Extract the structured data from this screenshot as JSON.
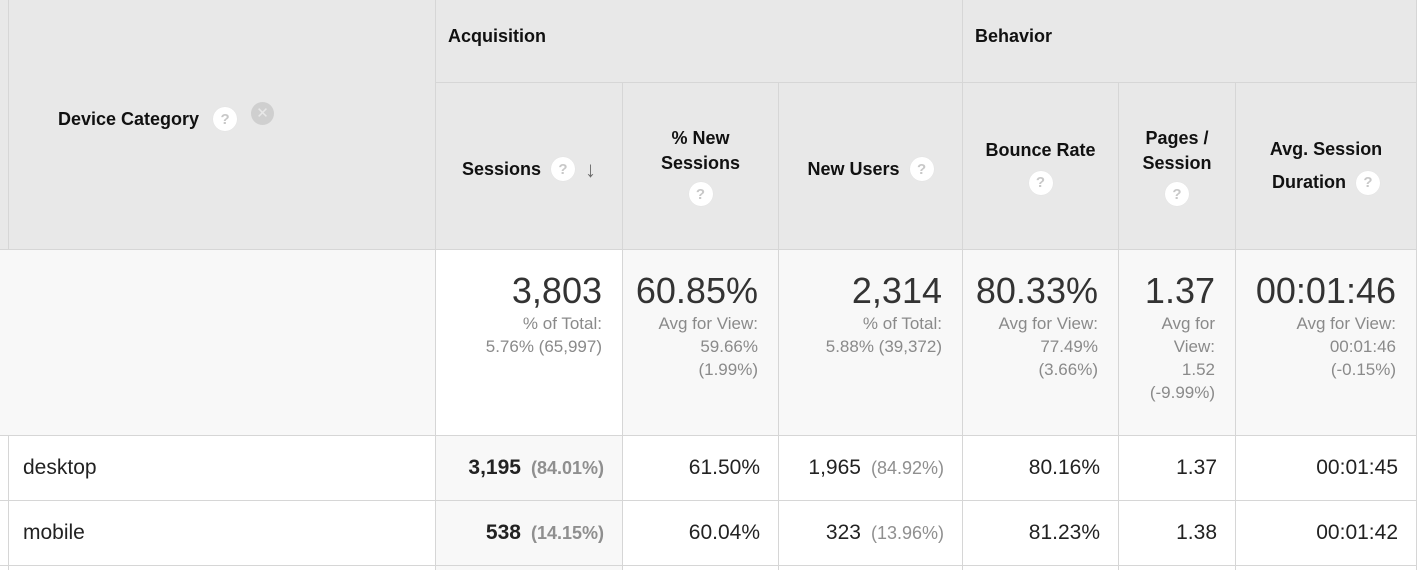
{
  "table": {
    "dimension": {
      "label": "Device Category",
      "help_icon": "question-circle",
      "remove_icon": "x-circle"
    },
    "groups": [
      {
        "label": "Acquisition"
      },
      {
        "label": "Behavior"
      }
    ],
    "columns": [
      {
        "line1": "Sessions",
        "line2": "",
        "sorted": true,
        "sort_icon": "arrow-down"
      },
      {
        "line1": "% New",
        "line2": "Sessions"
      },
      {
        "line1": "New Users",
        "line2": ""
      },
      {
        "line1": "Bounce Rate",
        "line2": ""
      },
      {
        "line1": "Pages /",
        "line2": "Session"
      },
      {
        "line1": "Avg. Session",
        "line2": "Duration"
      }
    ],
    "help_glyph": "?",
    "remove_glyph": "✕",
    "sort_glyph": "↓",
    "totals": [
      {
        "value": "3,803",
        "sub": [
          "% of Total:",
          "5.76% (65,997)"
        ]
      },
      {
        "value": "60.85%",
        "sub": [
          "Avg for View:",
          "59.66%",
          "(1.99%)"
        ]
      },
      {
        "value": "2,314",
        "sub": [
          "% of Total:",
          "5.88% (39,372)"
        ]
      },
      {
        "value": "80.33%",
        "sub": [
          "Avg for View:",
          "77.49%",
          "(3.66%)"
        ]
      },
      {
        "value": "1.37",
        "sub": [
          "Avg for",
          "View:",
          "1.52",
          "(-9.99%)"
        ]
      },
      {
        "value": "00:01:46",
        "sub": [
          "Avg for View:",
          "00:01:46",
          "(-0.15%)"
        ]
      }
    ],
    "rows": [
      {
        "dimension": "desktop",
        "sessions": "3,195",
        "sessions_pct": "(84.01%)",
        "new_sessions_pct": "61.50%",
        "new_users": "1,965",
        "new_users_pct": "(84.92%)",
        "bounce_rate": "80.16%",
        "pages_per_session": "1.37",
        "avg_duration": "00:01:45"
      },
      {
        "dimension": "mobile",
        "sessions": "538",
        "sessions_pct": "(14.15%)",
        "new_sessions_pct": "60.04%",
        "new_users": "323",
        "new_users_pct": "(13.96%)",
        "bounce_rate": "81.23%",
        "pages_per_session": "1.38",
        "avg_duration": "00:01:42"
      }
    ]
  }
}
